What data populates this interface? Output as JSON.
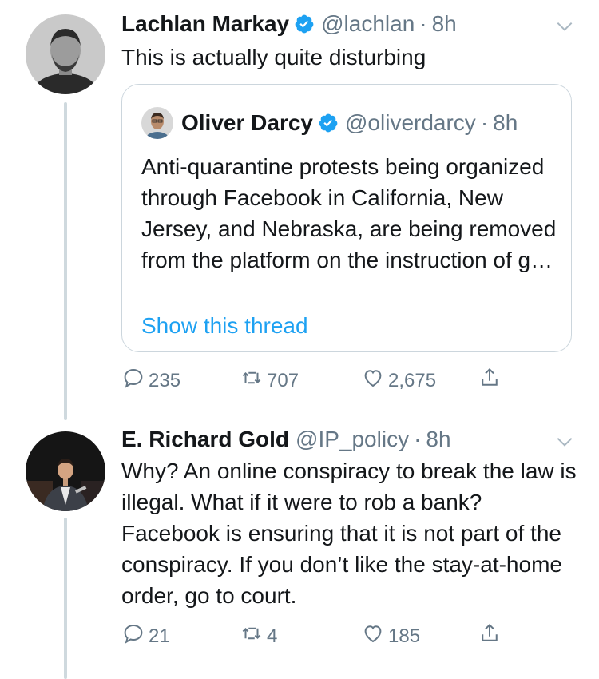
{
  "tweets": [
    {
      "name": "Lachlan Markay",
      "handle": "@lachlan",
      "time": "8h",
      "text": "This is actually quite disturbing",
      "quote": {
        "name": "Oliver Darcy",
        "handle": "@oliverdarcy",
        "time": "8h",
        "text": "Anti-quarantine protests being organized through Facebook in California, New Jersey, and Nebraska, are being removed from the platform on the instruction of g…",
        "show_thread": "Show this thread"
      },
      "replies": "235",
      "retweets": "707",
      "likes": "2,675"
    },
    {
      "name": "E. Richard Gold",
      "handle": "@IP_policy",
      "time": "8h",
      "text": "Why? An online conspiracy to break the law is illegal. What if it were to rob a bank? Facebook is ensuring that it is not part of the conspiracy. If you don’t like the stay-at-home order, go to court.",
      "replies": "21",
      "retweets": "4",
      "likes": "185"
    }
  ],
  "separator": "·",
  "colors": {
    "accent": "#1da1f2",
    "muted": "#657786",
    "text": "#14171a",
    "line": "#cfd9de"
  },
  "icons": [
    "verified-badge-icon",
    "chevron-down-icon",
    "reply-icon",
    "retweet-icon",
    "like-icon",
    "share-icon"
  ]
}
